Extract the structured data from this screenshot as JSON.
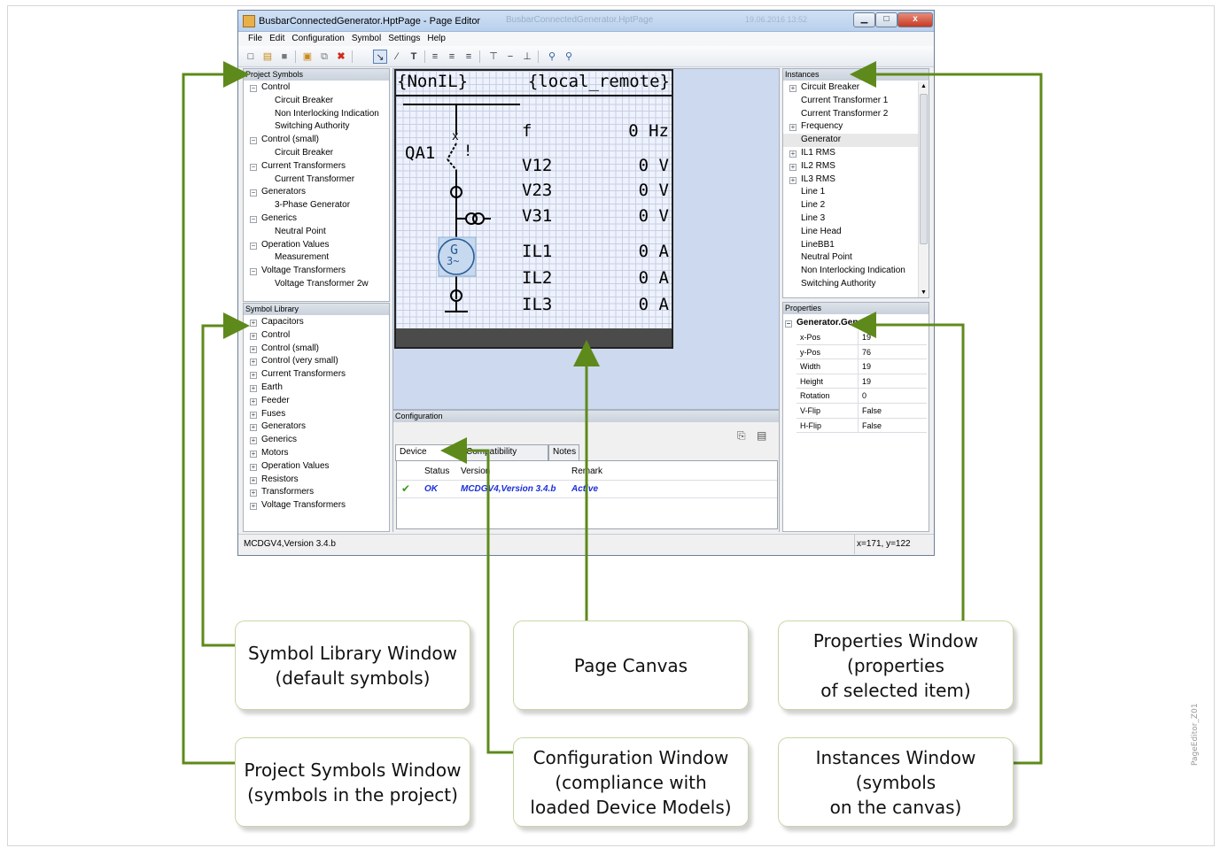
{
  "window": {
    "title": "BusbarConnectedGenerator.HptPage - Page Editor",
    "ghost_title": "BusbarConnectedGenerator.HptPage",
    "ghost_date": "19.06.2016 13:52",
    "min_glyph": "▁",
    "max_glyph": "□",
    "close_glyph": "x",
    "menu": [
      "File",
      "Edit",
      "Configuration",
      "Symbol",
      "Settings",
      "Help"
    ]
  },
  "toolbar_icons": [
    "new-icon",
    "open-icon",
    "save-icon",
    "paste-icon",
    "copy-icon",
    "delete-icon",
    "select-tool-icon",
    "line-tool-icon",
    "text-tool-icon",
    "align-left-icon",
    "align-center-icon",
    "align-right-icon",
    "align-top-icon",
    "align-middle-icon",
    "align-bottom-icon",
    "zoom-in-icon",
    "zoom-out-icon"
  ],
  "project_symbols": {
    "title": "Project Symbols",
    "groups": [
      {
        "label": "Control",
        "items": [
          "Circuit Breaker",
          "Non Interlocking Indication",
          "Switching Authority"
        ]
      },
      {
        "label": "Control (small)",
        "items": [
          "Circuit Breaker"
        ]
      },
      {
        "label": "Current Transformers",
        "items": [
          "Current Transformer"
        ]
      },
      {
        "label": "Generators",
        "items": [
          "3-Phase Generator"
        ]
      },
      {
        "label": "Generics",
        "items": [
          "Neutral Point"
        ]
      },
      {
        "label": "Operation Values",
        "items": [
          "Measurement"
        ]
      },
      {
        "label": "Voltage Transformers",
        "items": [
          "Voltage Transformer 2w"
        ]
      }
    ]
  },
  "symbol_library": {
    "title": "Symbol Library",
    "items": [
      "Capacitors",
      "Control",
      "Control (small)",
      "Control (very small)",
      "Current Transformers",
      "Earth",
      "Feeder",
      "Fuses",
      "Generators",
      "Generics",
      "Motors",
      "Operation Values",
      "Resistors",
      "Transformers",
      "Voltage Transformers"
    ]
  },
  "canvas": {
    "header_left": "{NonIL}",
    "header_right": "{local_remote}",
    "breaker_label": "QA1",
    "generator_top": "G",
    "generator_bottom": "3~",
    "readings": [
      {
        "name": "f",
        "value": "0 Hz"
      },
      {
        "name": "V12",
        "value": "0 V"
      },
      {
        "name": "V23",
        "value": "0 V"
      },
      {
        "name": "V31",
        "value": "0 V"
      },
      {
        "name": "IL1",
        "value": "0 A"
      },
      {
        "name": "IL2",
        "value": "0 A"
      },
      {
        "name": "IL3",
        "value": "0 A"
      }
    ]
  },
  "instances": {
    "title": "Instances",
    "items": [
      {
        "label": "Circuit Breaker",
        "expandable": true
      },
      {
        "label": "Current Transformer 1",
        "expandable": false
      },
      {
        "label": "Current Transformer 2",
        "expandable": false
      },
      {
        "label": "Frequency",
        "expandable": true
      },
      {
        "label": "Generator",
        "expandable": false,
        "selected": true
      },
      {
        "label": "IL1 RMS",
        "expandable": true
      },
      {
        "label": "IL2 RMS",
        "expandable": true
      },
      {
        "label": "IL3 RMS",
        "expandable": true
      },
      {
        "label": "Line 1",
        "expandable": false
      },
      {
        "label": "Line 2",
        "expandable": false
      },
      {
        "label": "Line 3",
        "expandable": false
      },
      {
        "label": "Line Head",
        "expandable": false
      },
      {
        "label": "LineBB1",
        "expandable": false
      },
      {
        "label": "Neutral Point",
        "expandable": false
      },
      {
        "label": "Non Interlocking Indication",
        "expandable": false
      },
      {
        "label": "Switching Authority",
        "expandable": false
      }
    ]
  },
  "properties": {
    "title": "Properties",
    "object": "Generator.Generic",
    "rows": [
      {
        "key": "x-Pos",
        "value": "19"
      },
      {
        "key": "y-Pos",
        "value": "76"
      },
      {
        "key": "Width",
        "value": "19"
      },
      {
        "key": "Height",
        "value": "19"
      },
      {
        "key": "Rotation",
        "value": "0"
      },
      {
        "key": "V-Flip",
        "value": "False"
      },
      {
        "key": "H-Flip",
        "value": "False"
      }
    ]
  },
  "configuration": {
    "title": "Configuration",
    "tabs": [
      "Device Models",
      "Compatibility Check",
      "Notes"
    ],
    "columns": [
      "Status",
      "Version",
      "Remark"
    ],
    "row": {
      "status": "OK",
      "version": "MCDGV4,Version 3.4.b",
      "remark": "Active"
    }
  },
  "statusbar": {
    "left": "MCDGV4,Version 3.4.b",
    "right": "x=171, y=122"
  },
  "callouts": {
    "symbol_library": "Symbol Library Window\n(default symbols)",
    "page_canvas": "Page Canvas",
    "properties": "Properties Window\n(properties\nof selected item)",
    "project_symbols": "Project Symbols Window\n(symbols in the project)",
    "configuration": "Configuration Window\n(compliance with\nloaded Device Models)",
    "instances": "Instances Window\n(symbols\non the canvas)"
  },
  "side_label": "PageEditor_Z01",
  "colors": {
    "arrow": "#5e8a1b",
    "callout_border": "#c7d6a5",
    "accent_ok": "#1c2fd8"
  }
}
